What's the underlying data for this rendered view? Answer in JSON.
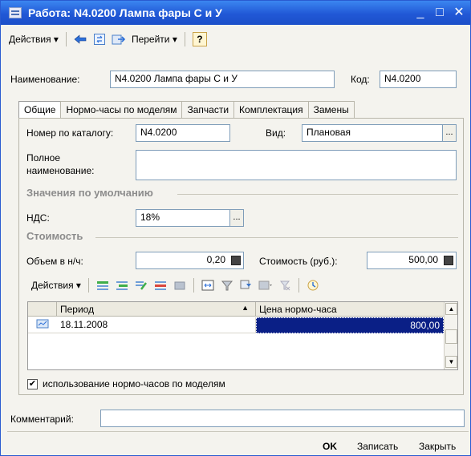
{
  "window": {
    "title": "Работа: N4.0200 Лампа фары С и У",
    "controls": {
      "minimize": "_",
      "maximize": "□",
      "close": "✕"
    }
  },
  "toolbar": {
    "actions_label": "Действия",
    "goto_label": "Перейти",
    "help_label": "?"
  },
  "header": {
    "name_label": "Наименование:",
    "name_value": "N4.0200 Лампа фары С и У",
    "code_label": "Код:",
    "code_value": "N4.0200"
  },
  "tabs": [
    {
      "label": "Общие",
      "active": true
    },
    {
      "label": "Нормо-часы по моделям",
      "active": false
    },
    {
      "label": "Запчасти",
      "active": false
    },
    {
      "label": "Комплектация",
      "active": false
    },
    {
      "label": "Замены",
      "active": false
    }
  ],
  "general": {
    "catalog_label": "Номер по каталогу:",
    "catalog_value": "N4.0200",
    "kind_label": "Вид:",
    "kind_value": "Плановая",
    "fullname_label_line1": "Полное",
    "fullname_label_line2": "наименование:",
    "fullname_value": "",
    "defaults_title": "Значения по умолчанию",
    "vat_label": "НДС:",
    "vat_value": "18%",
    "cost_title": "Стоимость",
    "volume_label": "Объем в н/ч:",
    "volume_value": "0,20",
    "cost_label": "Стоимость (руб.):",
    "cost_value": "500,00"
  },
  "grid_toolbar": {
    "actions_label": "Действия"
  },
  "grid": {
    "columns": [
      "Период",
      "Цена нормо-часа"
    ],
    "rows": [
      {
        "period": "18.11.2008",
        "price": "800,00"
      }
    ]
  },
  "checkbox": {
    "label": "использование нормо-часов по моделям",
    "checked": true,
    "mark": "✔"
  },
  "comment": {
    "label": "Комментарий:",
    "value": ""
  },
  "buttons": {
    "ok": "OK",
    "save": "Записать",
    "close": "Закрыть"
  },
  "ellipsis": "...",
  "colors": {
    "titlebar": "#2158d6",
    "selection": "#0a1f86",
    "window_bg": "#f4f3ee"
  }
}
